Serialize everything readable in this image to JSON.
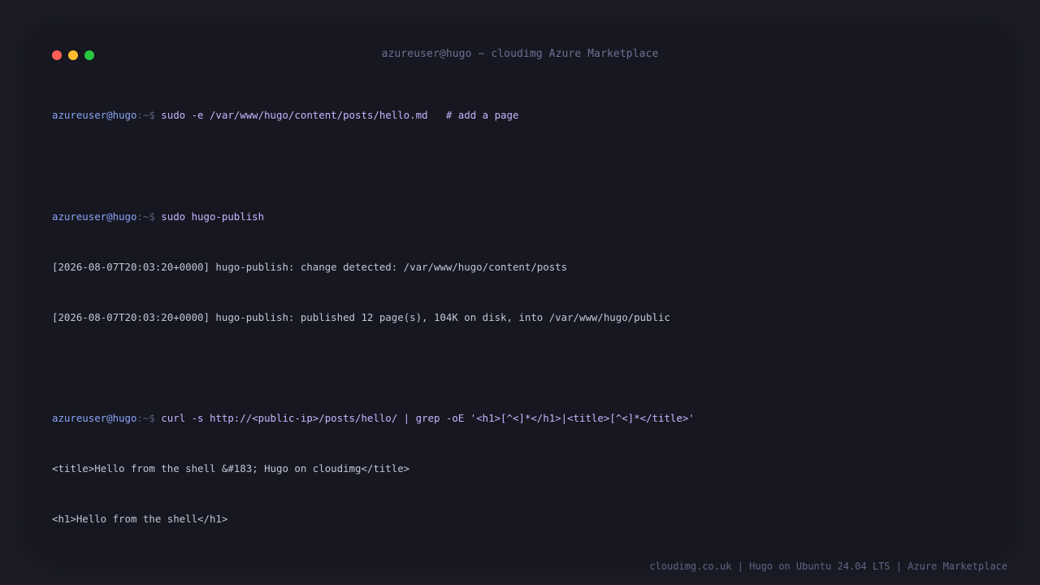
{
  "window": {
    "title": "azureuser@hugo ~ cloudimg Azure Marketplace",
    "controls": {
      "close_color": "#ff5f57",
      "minimize_color": "#febc2e",
      "maximize_color": "#28c840"
    }
  },
  "terminal": {
    "prompt": {
      "user": "azureuser@hugo",
      "path": ":~$ "
    },
    "commands": [
      "sudo -e /var/www/hugo/content/posts/hello.md   # add a page",
      "sudo hugo-publish",
      "curl -s http://<public-ip>/posts/hello/ | grep -oE '<h1>[^<]*</h1>|<title>[^<]*</title>'"
    ],
    "output": [
      "[2026-08-07T20:03:20+0000] hugo-publish: change detected: /var/www/hugo/content/posts",
      "[2026-08-07T20:03:20+0000] hugo-publish: published 12 page(s), 104K on disk, into /var/www/hugo/public",
      "<title>Hello from the shell &#183; Hugo on cloudimg</title>",
      "<h1>Hello from the shell</h1>"
    ]
  },
  "footer": {
    "text": "cloudimg.co.uk | Hugo on Ubuntu 24.04 LTS | Azure Marketplace"
  },
  "colors": {
    "background": "#1b1c26",
    "window_bg": "#161720",
    "prompt_user": "#8ba4f7",
    "prompt_path": "#5a607c",
    "command": "#c5b6ff",
    "output": "#c2c6d6"
  }
}
